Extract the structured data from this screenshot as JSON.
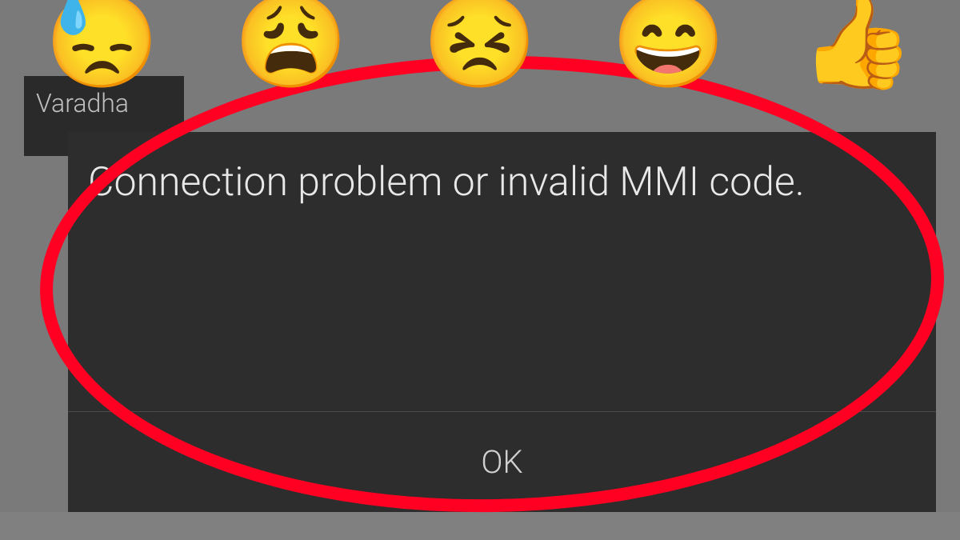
{
  "background": {
    "contact_name": "Varadha"
  },
  "dialog": {
    "message": "Connection problem or invalid MMI code.",
    "ok_label": "OK"
  },
  "emojis": {
    "e1": "😓",
    "e2": "😩",
    "e3": "😣",
    "e4": "😄",
    "e5": "👍"
  }
}
